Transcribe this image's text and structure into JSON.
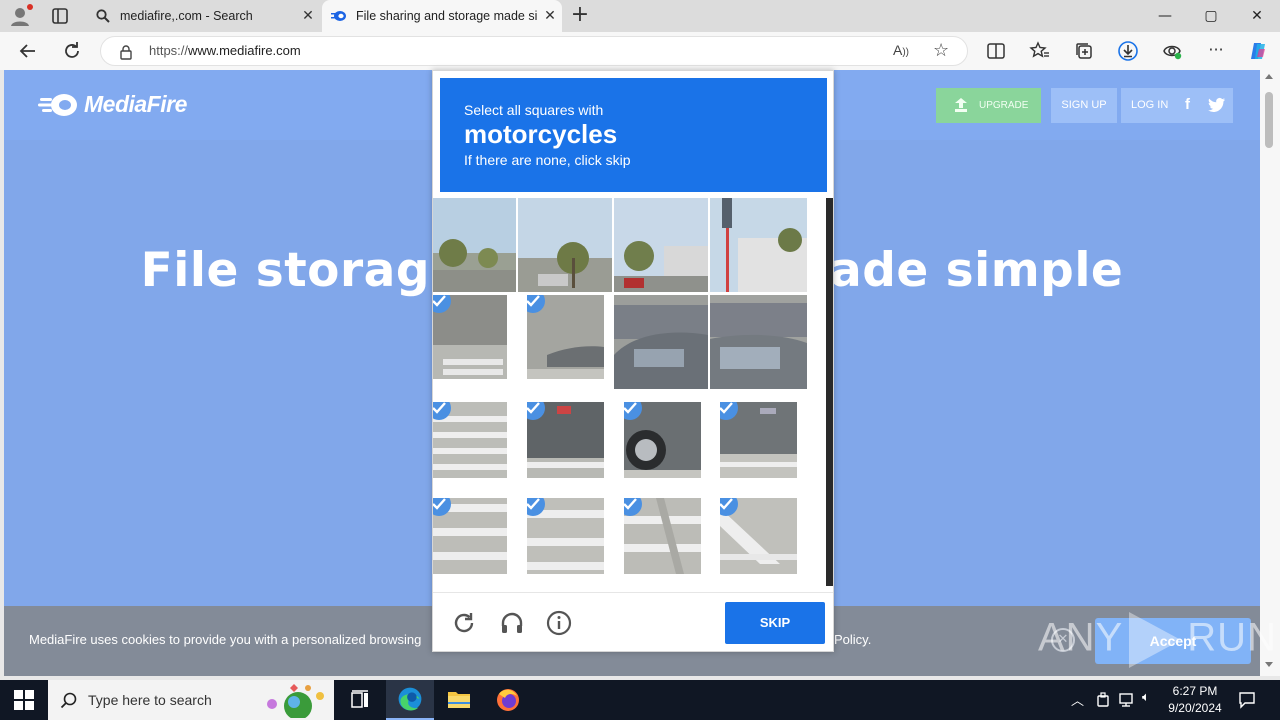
{
  "browser": {
    "tabs": [
      {
        "title": "mediafire,.com - Search",
        "active": false
      },
      {
        "title": "File sharing and storage made si",
        "active": true
      }
    ],
    "address": {
      "prefix": "https://",
      "host": "www.mediafire.com"
    },
    "window_controls": {
      "minimize": "—",
      "maximize": "▢",
      "close": "✕"
    }
  },
  "site": {
    "logo_text": "MediaFire",
    "upgrade_label": "UPGRADE",
    "signup_label": "SIGN UP",
    "login_label": "LOG IN",
    "facebook_glyph": "f",
    "headline_left": "File storag",
    "headline_right": "ade simple",
    "cookie_text": "MediaFire uses cookies to provide you with a personalized browsing",
    "cookie_text_end": "Policy.",
    "accept_label": "Accept"
  },
  "captcha": {
    "instruction_line1": "Select all squares with",
    "target": "motorcycles",
    "instruction_line3": "If there are none, click skip",
    "skip_label": "SKIP",
    "selected_tiles": [
      5,
      6,
      9,
      10,
      11,
      12,
      13,
      14,
      15,
      16
    ]
  },
  "watermark": {
    "text_left": "ANY",
    "text_right": "RUN"
  },
  "taskbar": {
    "search_placeholder": "Type here to search",
    "time": "6:27 PM",
    "date": "9/20/2024"
  },
  "colors": {
    "mediafire_blue": "#1c64e4",
    "captcha_blue": "#1a73e8",
    "upgrade_green": "#2ab34a",
    "check_blue": "#4a90e2",
    "taskbar": "#101724"
  }
}
